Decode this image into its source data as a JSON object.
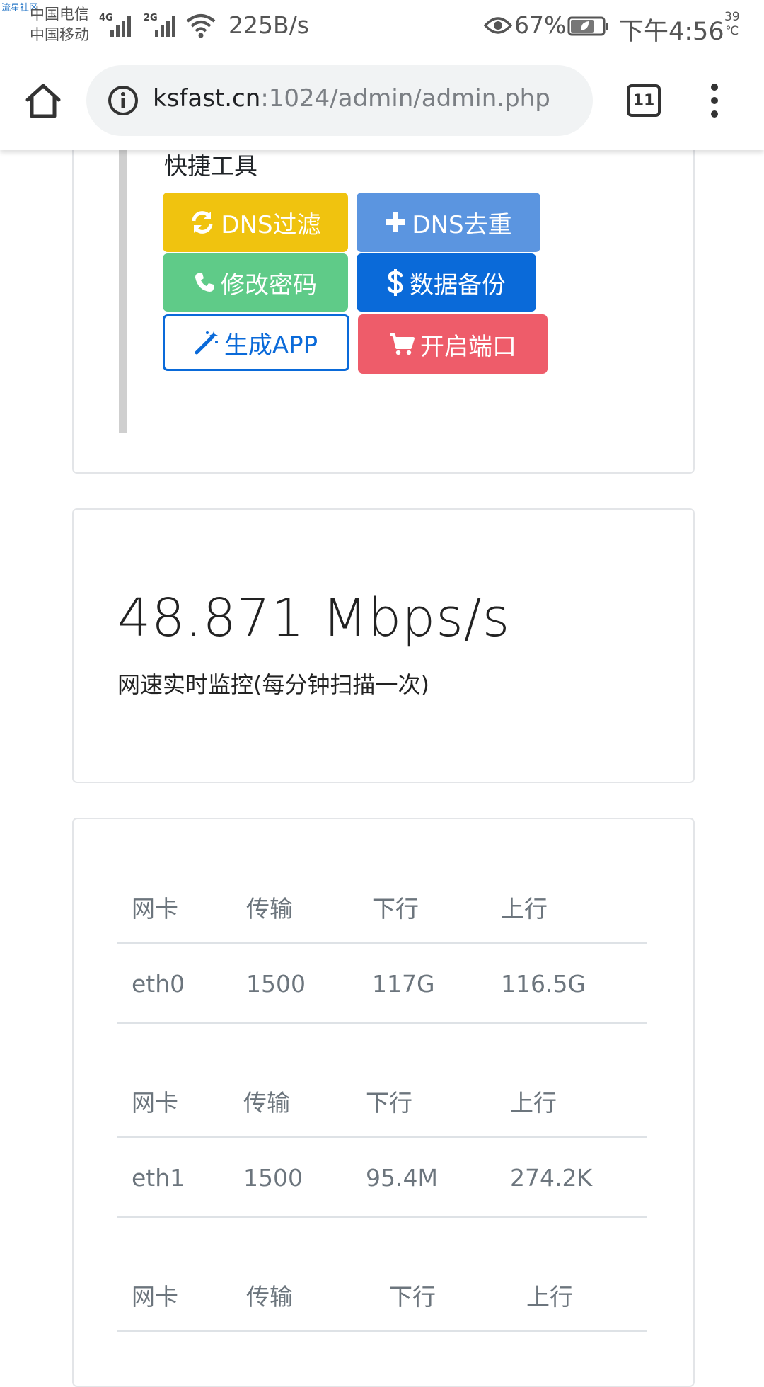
{
  "status_bar": {
    "watermark": "流星社区",
    "carrier1": "中国电信",
    "carrier2": "中国移动",
    "net1": "4G",
    "net2": "2G",
    "speed": "225B/s",
    "battery_pct": "67%",
    "time": "下午4:56",
    "temp_value": "39",
    "temp_unit": "℃"
  },
  "browser": {
    "url_host": "ksfast.cn",
    "url_rest": ":1024/admin/admin.php",
    "tab_count": "11",
    "icons": [
      "home-icon",
      "info-icon",
      "tabs-icon",
      "more-vert-icon"
    ]
  },
  "quick_tools": {
    "title": "快捷工具",
    "buttons": [
      {
        "label": "DNS过滤",
        "icon": "refresh-icon",
        "color": "#f0c30f"
      },
      {
        "label": "DNS去重",
        "icon": "plus-icon",
        "color": "#5b95e0"
      },
      {
        "label": "修改密码",
        "icon": "phone-icon",
        "color": "#5fcb88"
      },
      {
        "label": "数据备份",
        "icon": "dollar-icon",
        "color": "#0a6ad9"
      },
      {
        "label": "生成APP",
        "icon": "magic-wand-icon",
        "color": "#0a6ad9"
      },
      {
        "label": "开启端口",
        "icon": "cart-icon",
        "color": "#ee5c6a"
      }
    ]
  },
  "speed_monitor": {
    "value": "48.871 Mbps/s",
    "caption": "网速实时监控(每分钟扫描一次)"
  },
  "nic_table": {
    "headers": [
      "网卡",
      "传输",
      "下行",
      "上行"
    ],
    "rows": [
      [
        "eth0",
        "1500",
        "117G",
        "116.5G"
      ],
      [
        "eth1",
        "1500",
        "95.4M",
        "274.2K"
      ]
    ]
  }
}
